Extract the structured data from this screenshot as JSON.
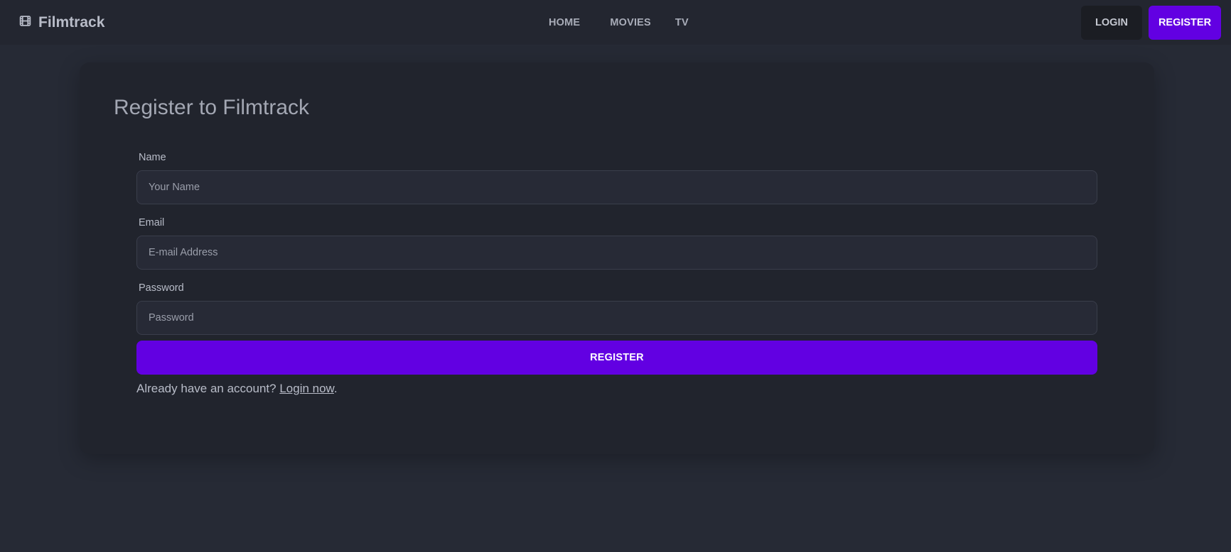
{
  "navbar": {
    "brand": "Filmtrack",
    "brand_icon": "film-icon",
    "links": [
      "HOME",
      "MOVIES",
      "TV"
    ],
    "login_label": "LOGIN",
    "register_label": "REGISTER"
  },
  "register_form": {
    "title": "Register to Filmtrack",
    "name_label": "Name",
    "name_placeholder": "Your Name",
    "email_label": "Email",
    "email_placeholder": "E-mail Address",
    "password_label": "Password",
    "password_placeholder": "Password",
    "submit_label": "REGISTER",
    "already_text": "Already have an account?",
    "login_link": "Login now",
    "trailing_period": "."
  },
  "colors": {
    "background": "#262a35",
    "navbar": "#232630",
    "card": "#21242d",
    "accent": "#6200e2"
  }
}
